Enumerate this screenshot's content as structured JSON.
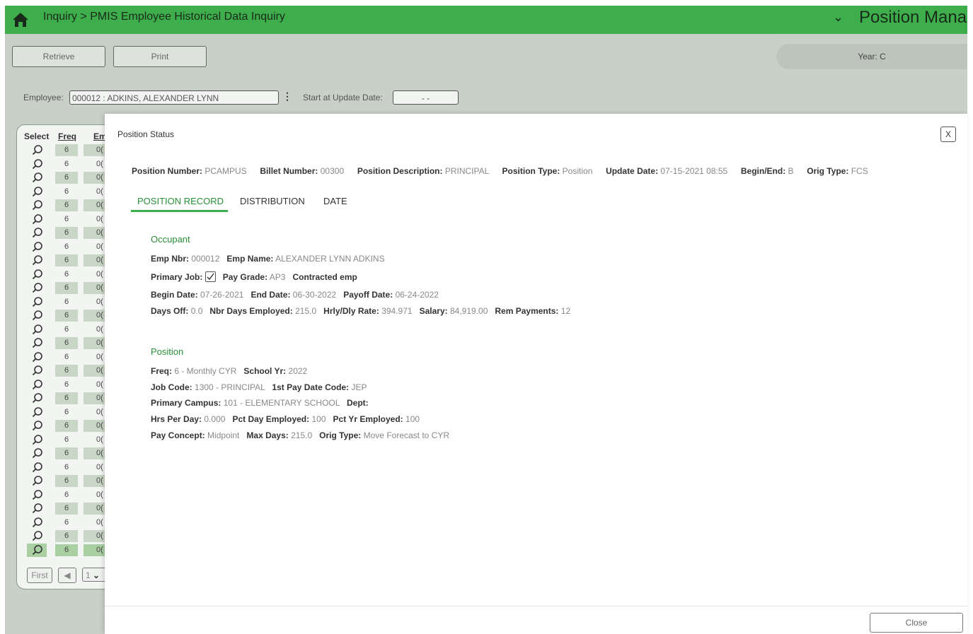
{
  "topbar": {
    "breadcrumb": "Inquiry > PMIS Employee Historical Data Inquiry",
    "app_title": "Position Management",
    "bg_color": "#3dae4b"
  },
  "toolbar": {
    "retrieve_label": "Retrieve",
    "print_label": "Print",
    "year_label": "Year:",
    "year_value": "C"
  },
  "employee_bar": {
    "employee_label": "Employee:",
    "employee_value": "000012 : ADKINS, ALEXANDER LYNN",
    "start_label": "Start at Update Date:",
    "start_value": "- -"
  },
  "list": {
    "headers": {
      "select": "Select",
      "freq": "Freq",
      "emp": "Em"
    },
    "rows": [
      {
        "freq": "6",
        "emp": "0("
      },
      {
        "freq": "6",
        "emp": "0("
      },
      {
        "freq": "6",
        "emp": "0("
      },
      {
        "freq": "6",
        "emp": "0("
      },
      {
        "freq": "6",
        "emp": "0("
      },
      {
        "freq": "6",
        "emp": "0("
      },
      {
        "freq": "6",
        "emp": "0("
      },
      {
        "freq": "6",
        "emp": "0("
      },
      {
        "freq": "6",
        "emp": "0("
      },
      {
        "freq": "6",
        "emp": "0("
      },
      {
        "freq": "6",
        "emp": "0("
      },
      {
        "freq": "6",
        "emp": "0("
      },
      {
        "freq": "6",
        "emp": "0("
      },
      {
        "freq": "6",
        "emp": "0("
      },
      {
        "freq": "6",
        "emp": "0("
      },
      {
        "freq": "6",
        "emp": "0("
      },
      {
        "freq": "6",
        "emp": "0("
      },
      {
        "freq": "6",
        "emp": "0("
      },
      {
        "freq": "6",
        "emp": "0("
      },
      {
        "freq": "6",
        "emp": "0("
      },
      {
        "freq": "6",
        "emp": "0("
      },
      {
        "freq": "6",
        "emp": "0("
      },
      {
        "freq": "6",
        "emp": "0("
      },
      {
        "freq": "6",
        "emp": "0("
      },
      {
        "freq": "6",
        "emp": "0("
      },
      {
        "freq": "6",
        "emp": "0("
      },
      {
        "freq": "6",
        "emp": "0("
      },
      {
        "freq": "6",
        "emp": "0("
      },
      {
        "freq": "6",
        "emp": "0("
      },
      {
        "freq": "6",
        "emp": "0("
      }
    ],
    "highlighted_row": 29,
    "pager": {
      "first": "First",
      "prev": "◀",
      "page": "1"
    }
  },
  "modal": {
    "title": "Position Status",
    "close_x": "X",
    "position": {
      "number_label": "Position Number:",
      "number_value": "PCAMPUS",
      "billet_label": "Billet Number:",
      "billet_value": "00300",
      "desc_label": "Position Description:",
      "desc_value": "PRINCIPAL",
      "type_label": "Position Type:",
      "type_value": "Position",
      "update_label": "Update Date:",
      "update_value": "07-15-2021 08:55",
      "beginend_label": "Begin/End:",
      "beginend_value": "B",
      "origtype_label": "Orig Type:",
      "origtype_value": "FCS"
    },
    "tabs": [
      "POSITION RECORD",
      "DISTRIBUTION",
      "DATE"
    ],
    "occupant": {
      "heading": "Occupant",
      "emp_nbr_label": "Emp Nbr:",
      "emp_nbr_value": "000012",
      "emp_name_label": "Emp Name:",
      "emp_name_value": "ALEXANDER LYNN ADKINS",
      "primary_job_label": "Primary Job:",
      "pay_grade_label": "Pay Grade:",
      "pay_grade_value": "AP3",
      "contracted_label": "Contracted emp",
      "begin_label": "Begin Date:",
      "begin_value": "07-26-2021",
      "end_label": "End Date:",
      "end_value": "06-30-2022",
      "payoff_label": "Payoff Date:",
      "payoff_value": "06-24-2022",
      "days_off_label": "Days Off:",
      "days_off_value": "0.0",
      "nbr_days_label": "Nbr Days Employed:",
      "nbr_days_value": "215.0",
      "rate_label": "Hrly/Dly Rate:",
      "rate_value": "394.971",
      "salary_label": "Salary:",
      "salary_value": "84,919.00",
      "rem_label": "Rem Payments:",
      "rem_value": "12"
    },
    "position_section": {
      "heading": "Position",
      "freq_label": "Freq:",
      "freq_value": "6 - Monthly CYR",
      "school_yr_label": "School Yr:",
      "school_yr_value": "2022",
      "job_code_label": "Job Code:",
      "job_code_value": "1300 - PRINCIPAL",
      "pay_date_label": "1st Pay Date Code:",
      "pay_date_value": "JEP",
      "campus_label": "Primary Campus:",
      "campus_value": "101 - ELEMENTARY SCHOOL",
      "dept_label": "Dept:",
      "hrs_label": "Hrs Per Day:",
      "hrs_value": "0.000",
      "pct_day_label": "Pct Day Employed:",
      "pct_day_value": "100",
      "pct_yr_label": "Pct Yr Employed:",
      "pct_yr_value": "100",
      "concept_label": "Pay Concept:",
      "concept_value": "Midpoint",
      "max_days_label": "Max Days:",
      "max_days_value": "215.0",
      "orig_type_label": "Orig Type:",
      "orig_type_value": "Move Forecast to CYR"
    },
    "close_label": "Close"
  }
}
